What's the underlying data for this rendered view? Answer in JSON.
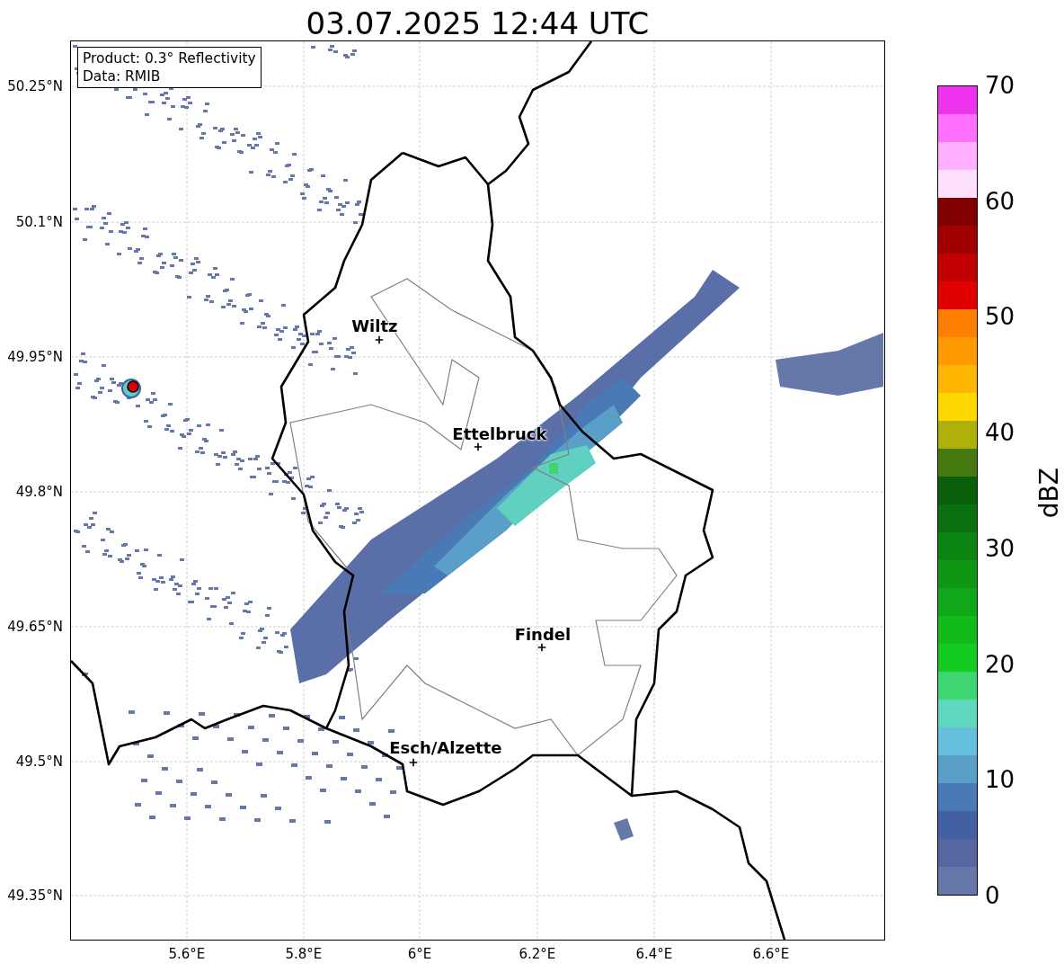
{
  "title": "03.07.2025 12:44 UTC",
  "info_box": [
    "Product: 0.3° Reflectivity",
    "Data: RMIB"
  ],
  "map": {
    "y_ticks": [
      "50.25°N",
      "50.1°N",
      "49.95°N",
      "49.8°N",
      "49.65°N",
      "49.5°N",
      "49.35°N"
    ],
    "x_ticks": [
      "5.6°E",
      "5.8°E",
      "6°E",
      "6.2°E",
      "6.4°E",
      "6.6°E"
    ],
    "places": [
      {
        "name": "Wiltz"
      },
      {
        "name": "Ettelbruck"
      },
      {
        "name": "Findel"
      },
      {
        "name": "Esch/Alzette"
      }
    ]
  },
  "colorbar": {
    "label": "dBZ",
    "ticks": [
      "70",
      "60",
      "50",
      "40",
      "30",
      "20",
      "10",
      "0"
    ],
    "bins": [
      {
        "color": "#6677aa"
      },
      {
        "color": "#5566a0"
      },
      {
        "color": "#4460a5"
      },
      {
        "color": "#4a7ab5"
      },
      {
        "color": "#5a9fc8"
      },
      {
        "color": "#66c0dd"
      },
      {
        "color": "#60d8c0"
      },
      {
        "color": "#3dd670"
      },
      {
        "color": "#14cc20"
      },
      {
        "color": "#12bb1a"
      },
      {
        "color": "#10a818"
      },
      {
        "color": "#0e9614"
      },
      {
        "color": "#0c8412"
      },
      {
        "color": "#0a7010"
      },
      {
        "color": "#0a5e0a"
      },
      {
        "color": "#467a10"
      },
      {
        "color": "#b0b00a"
      },
      {
        "color": "#ffd700"
      },
      {
        "color": "#ffb600"
      },
      {
        "color": "#ff9a00"
      },
      {
        "color": "#ff8000"
      },
      {
        "color": "#e00000"
      },
      {
        "color": "#c00000"
      },
      {
        "color": "#a00000"
      },
      {
        "color": "#800000"
      },
      {
        "color": "#ffe0ff"
      },
      {
        "color": "#ffb0ff"
      },
      {
        "color": "#ff70ff"
      },
      {
        "color": "#ee33ee"
      }
    ]
  }
}
